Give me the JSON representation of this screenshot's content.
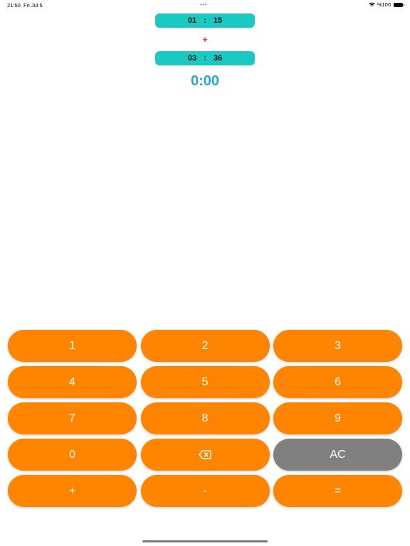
{
  "status_bar": {
    "time": "21:50",
    "date": "Fri Jul 5",
    "dots": "•••",
    "battery": "%100",
    "wifi_icon": "wifi-icon",
    "battery_icon": "battery-icon"
  },
  "time_a": {
    "hours": "01",
    "separator": ":",
    "minutes": "15"
  },
  "operator": "+",
  "time_b": {
    "hours": "03",
    "separator": ":",
    "minutes": "36"
  },
  "result": "0:00",
  "keypad": {
    "k1": "1",
    "k2": "2",
    "k3": "3",
    "k4": "4",
    "k5": "5",
    "k6": "6",
    "k7": "7",
    "k8": "8",
    "k9": "9",
    "k0": "0",
    "backspace_icon": "delete-backward-icon",
    "clear": "AC",
    "plus": "+",
    "minus": "-",
    "equals": "="
  },
  "colors": {
    "key_orange": "#ff8400",
    "key_gray": "#808080",
    "pill_teal": "#1ac9c2",
    "operator_red": "#e8413a",
    "result_blue": "#2aa6c8"
  }
}
